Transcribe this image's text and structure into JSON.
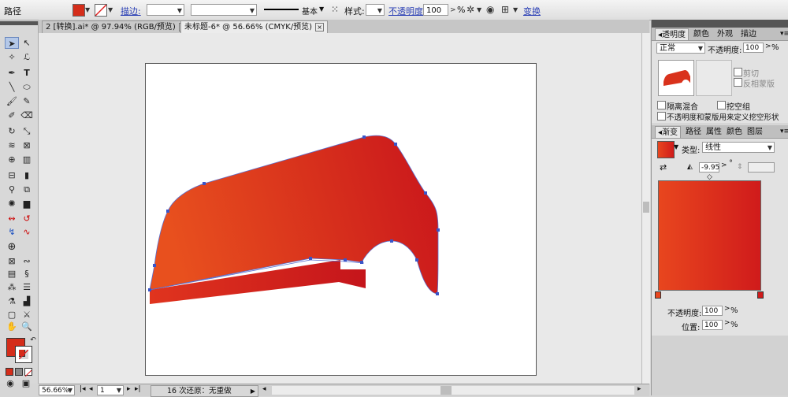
{
  "control_bar": {
    "object_type": "路径",
    "fill_color": "#d42d1a",
    "stroke_label": "描边:",
    "stroke_width": "",
    "brush_style_name": "基本",
    "style_label": "样式:",
    "opacity_label": "不透明度:",
    "opacity_value": "100",
    "opacity_unit": "%",
    "transform_label": "变换"
  },
  "document_tabs": [
    {
      "label": "2 [转换].ai* @ 97.94% (RGB/预览)"
    },
    {
      "label": "未标题-6* @ 56.66% (CMYK/预览)"
    }
  ],
  "transparency_panel": {
    "tabs": [
      "透明度",
      "颜色",
      "外观",
      "描边"
    ],
    "blend_mode": "正常",
    "opacity_label": "不透明度:",
    "opacity_value": "100",
    "opacity_unit": "%",
    "clip_label": "剪切",
    "invert_mask_label": "反相蒙版",
    "isolate_blend_label": "隔离混合",
    "knockout_group_label": "挖空组",
    "opacity_mask_knockout_label": "不透明度和蒙版用来定义挖空形状"
  },
  "gradient_panel": {
    "tabs": [
      "渐变",
      "路径",
      "属性",
      "颜色",
      "图层"
    ],
    "type_label": "类型:",
    "type_value": "线性",
    "angle_value": "-9.95",
    "angle_unit": "°",
    "start_color": "#e8461e",
    "end_color": "#d01b1b",
    "opacity_label": "不透明度:",
    "opacity_value": "100",
    "opacity_unit": "%",
    "location_label": "位置:",
    "location_value": "100",
    "location_unit": "%"
  },
  "tools_panel": {
    "fill_color": "#d42d1a",
    "stroke_color": "#ffffff"
  },
  "status_bar": {
    "zoom": "56.66%",
    "artboard_num": "1",
    "undo_info": "16 次还原：无重做"
  },
  "artwork": {
    "gradient_start": "#e8501e",
    "gradient_end": "#c9151b",
    "anchor_color": "#3a55c8"
  }
}
